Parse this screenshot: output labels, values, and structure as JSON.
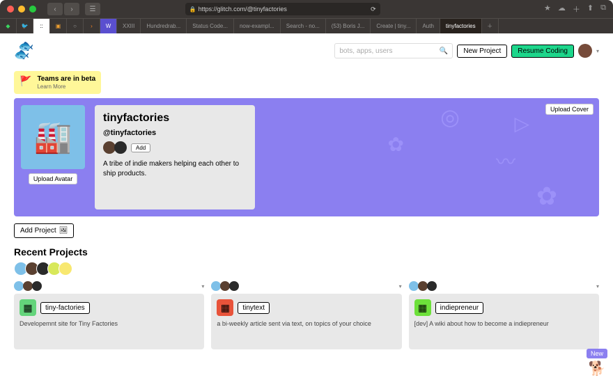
{
  "browser": {
    "url": "https://glitch.com/@tinyfactories",
    "tabs": [
      "XXIII",
      "Hundredrab...",
      "Status Code...",
      "now-exampl...",
      "Search - no...",
      "(53) Boris J...",
      "Create | tiny...",
      "Auth",
      "tinyfactories"
    ],
    "active_tab_index": 8
  },
  "header": {
    "search_placeholder": "bots, apps, users",
    "new_project": "New Project",
    "resume_coding": "Resume Coding"
  },
  "beta": {
    "title": "Teams are in beta",
    "learn": "Learn More"
  },
  "team": {
    "name": "tinyfactories",
    "handle": "@tinyfactories",
    "add": "Add",
    "description": "A tribe of indie makers helping each other to ship products.",
    "upload_avatar": "Upload Avatar",
    "upload_cover": "Upload Cover"
  },
  "actions": {
    "add_project": "Add Project"
  },
  "section": {
    "recent": "Recent Projects"
  },
  "projects": [
    {
      "name": "tiny-factories",
      "desc": "Developemnt site for Tiny Factories",
      "color": "#64d47b"
    },
    {
      "name": "tinytext",
      "desc": "a bi-weekly article sent via text, on topics of your choice",
      "color": "#e8533a"
    },
    {
      "name": "indiepreneur",
      "desc": "[dev] A wiki about how to become a indiepreneur",
      "color": "#6de03a"
    }
  ],
  "mascot": {
    "label": "New"
  }
}
